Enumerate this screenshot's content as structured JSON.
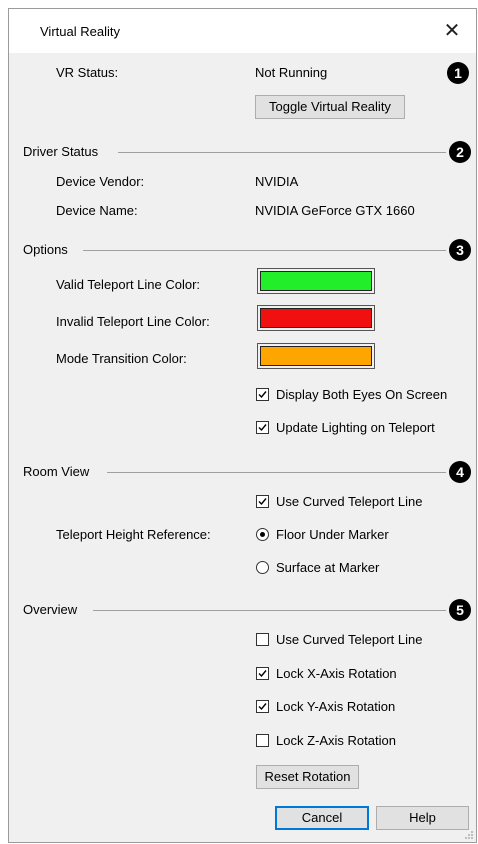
{
  "window": {
    "title": "Virtual Reality",
    "close_glyph": "✕"
  },
  "vr": {
    "status_label": "VR Status:",
    "status_value": "Not Running",
    "toggle_label": "Toggle Virtual Reality"
  },
  "driver": {
    "heading": "Driver Status",
    "badge": "2",
    "vendor_label": "Device Vendor:",
    "vendor_value": "NVIDIA",
    "name_label": "Device Name:",
    "name_value": "NVIDIA GeForce GTX 1660"
  },
  "status_badge": "1",
  "options": {
    "heading": "Options",
    "badge": "3",
    "valid_label": "Valid Teleport Line Color:",
    "valid_color": "#22ee2a",
    "invalid_label": "Invalid Teleport Line Color:",
    "invalid_color": "#f01010",
    "transition_label": "Mode Transition Color:",
    "transition_color": "#ffa500",
    "display_both_eyes": {
      "label": "Display Both Eyes On Screen",
      "checked": true
    },
    "update_lighting": {
      "label": "Update Lighting on Teleport",
      "checked": true
    }
  },
  "room_view": {
    "heading": "Room View",
    "badge": "4",
    "curved_line": {
      "label": "Use Curved Teleport Line",
      "checked": true
    },
    "height_ref_label": "Teleport Height Reference:",
    "height_ref_options": [
      "Floor Under Marker",
      "Surface at Marker"
    ],
    "height_ref_selected": "Floor Under Marker"
  },
  "overview": {
    "heading": "Overview",
    "badge": "5",
    "curved_line": {
      "label": "Use Curved Teleport Line",
      "checked": false
    },
    "lock_x": {
      "label": "Lock X-Axis Rotation",
      "checked": true
    },
    "lock_y": {
      "label": "Lock Y-Axis Rotation",
      "checked": true
    },
    "lock_z": {
      "label": "Lock Z-Axis Rotation",
      "checked": false
    },
    "reset_label": "Reset Rotation"
  },
  "footer": {
    "cancel_label": "Cancel",
    "help_label": "Help"
  }
}
